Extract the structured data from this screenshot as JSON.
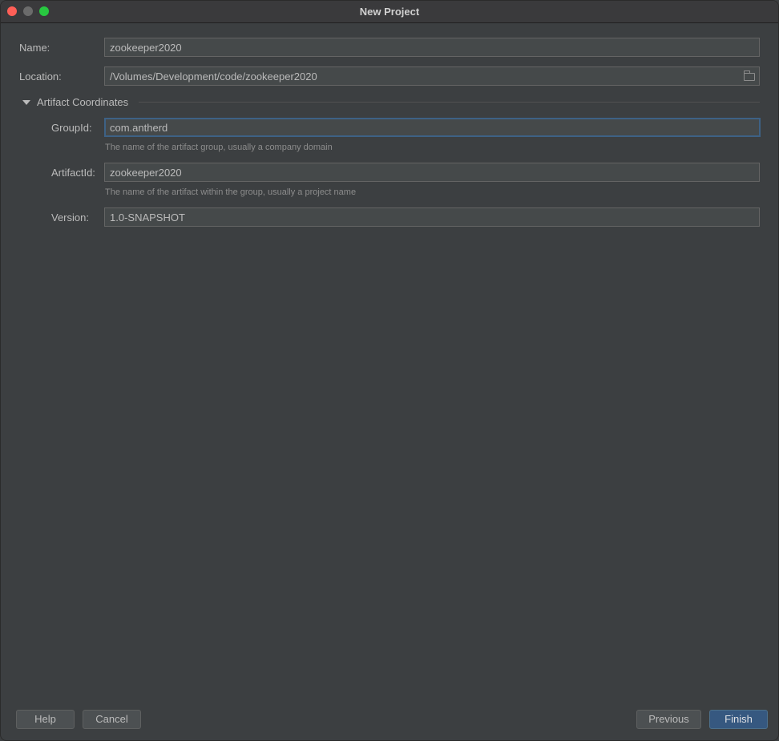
{
  "window": {
    "title": "New Project"
  },
  "form": {
    "name": {
      "label": "Name:",
      "value": "zookeeper2020"
    },
    "location": {
      "label": "Location:",
      "value": "/Volumes/Development/code/zookeeper2020"
    },
    "section": {
      "label": "Artifact Coordinates",
      "expanded": true
    },
    "group_id": {
      "label": "GroupId:",
      "value": "com.antherd",
      "hint": "The name of the artifact group, usually a company domain"
    },
    "artifact_id": {
      "label": "ArtifactId:",
      "value": "zookeeper2020",
      "hint": "The name of the artifact within the group, usually a project name"
    },
    "version": {
      "label": "Version:",
      "value": "1.0-SNAPSHOT"
    }
  },
  "footer": {
    "help_label": "Help",
    "cancel_label": "Cancel",
    "previous_label": "Previous",
    "finish_label": "Finish"
  },
  "colors": {
    "background": "#3c3f41",
    "field_background": "#45494a",
    "focus_border": "#3d6185",
    "primary_button": "#365880"
  }
}
